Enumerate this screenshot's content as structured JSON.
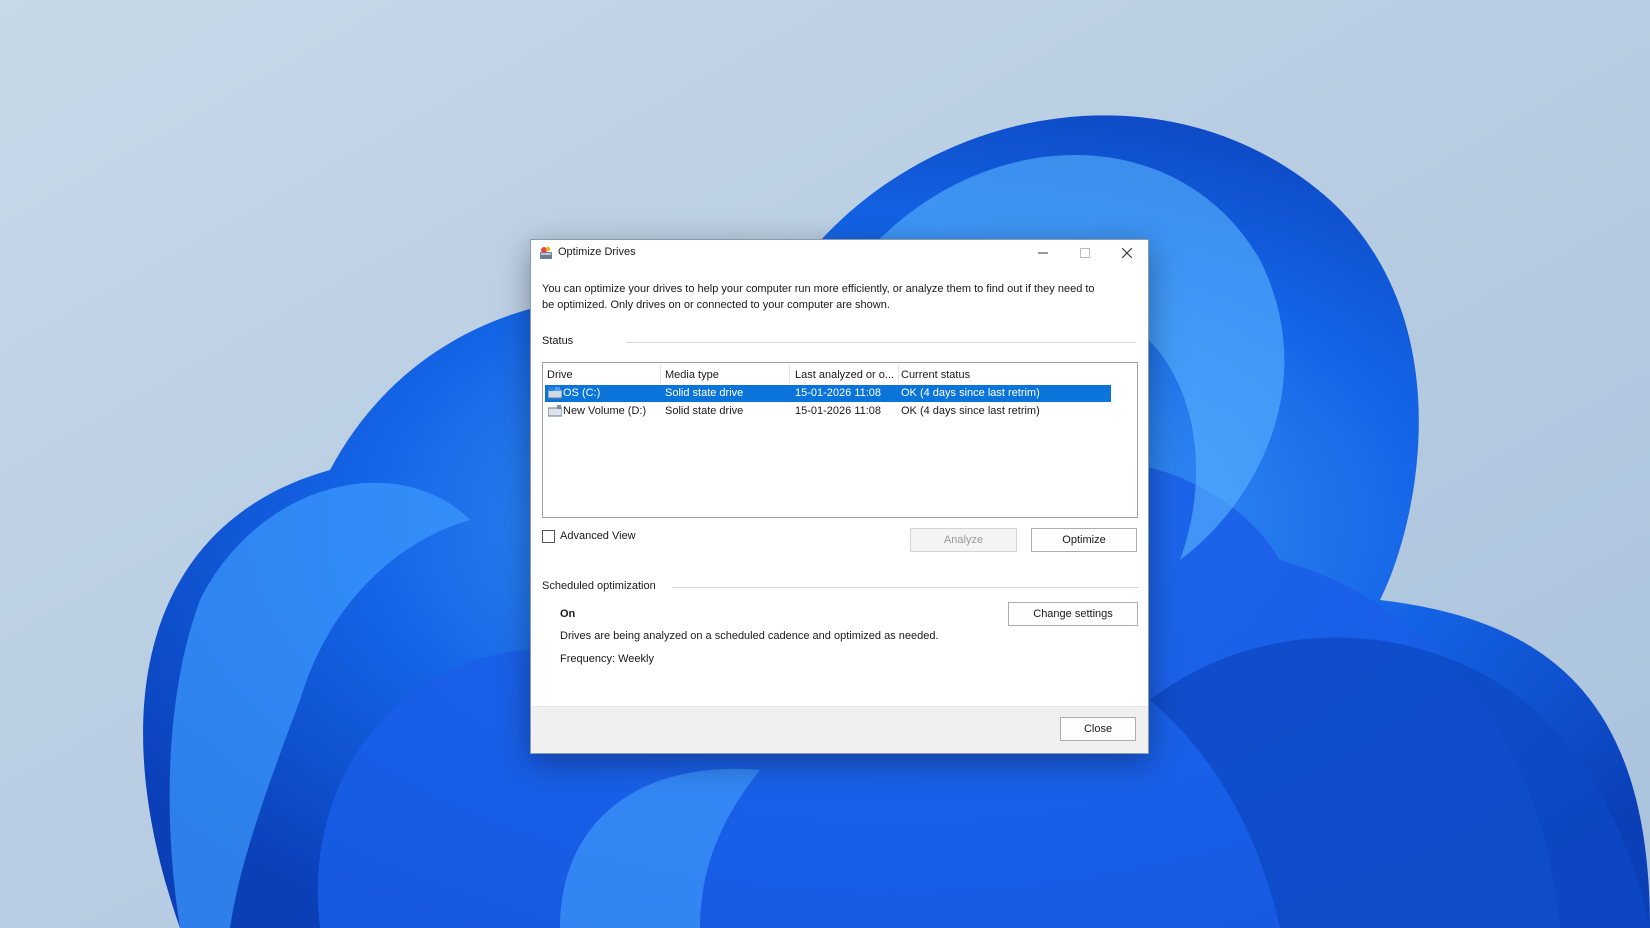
{
  "window": {
    "title": "Optimize Drives",
    "description": "You can optimize your drives to help your computer run more efficiently, or analyze them to find out if they need to be optimized. Only drives on or connected to your computer are shown."
  },
  "status": {
    "label": "Status",
    "columns": [
      "Drive",
      "Media type",
      "Last analyzed or o...",
      "Current status"
    ],
    "drives": [
      {
        "name": "OS (C:)",
        "media_type": "Solid state drive",
        "last_analyzed": "15-01-2026 11:08",
        "current_status": "OK (4 days since last retrim)",
        "selected": true
      },
      {
        "name": "New Volume (D:)",
        "media_type": "Solid state drive",
        "last_analyzed": "15-01-2026 11:08",
        "current_status": "OK (4 days since last retrim)",
        "selected": false
      }
    ]
  },
  "advanced_view": {
    "label": "Advanced View",
    "checked": false
  },
  "buttons": {
    "analyze": "Analyze",
    "optimize": "Optimize",
    "change_settings": "Change settings",
    "close": "Close"
  },
  "scheduled": {
    "label": "Scheduled optimization",
    "state": "On",
    "description": "Drives are being analyzed on a scheduled cadence and optimized as needed.",
    "frequency": "Frequency: Weekly"
  },
  "colors": {
    "selection": "#0a74da",
    "wallpaper_accent": "#1a5ee8"
  },
  "icons": {
    "app": "optimize-drives-icon",
    "drive": "hard-drive-icon",
    "minimize": "minimize-icon",
    "maximize": "maximize-icon",
    "close": "close-icon"
  }
}
